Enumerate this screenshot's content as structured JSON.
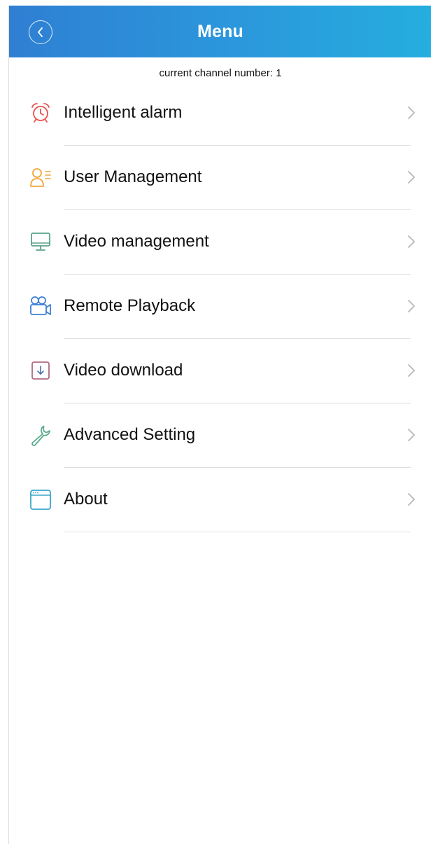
{
  "header": {
    "title": "Menu",
    "back_icon": "chevron-left-circle-icon"
  },
  "channel_info": "current channel number: 1",
  "menu": {
    "items": [
      {
        "label": "Intelligent alarm",
        "icon": "alarm-clock-icon",
        "icon_color": "#e8504f"
      },
      {
        "label": "User Management",
        "icon": "user-list-icon",
        "icon_color": "#f0a53a"
      },
      {
        "label": "Video management",
        "icon": "monitor-icon",
        "icon_color": "#5aa388"
      },
      {
        "label": "Remote Playback",
        "icon": "video-camera-icon",
        "icon_color": "#3d7fd6"
      },
      {
        "label": "Video download",
        "icon": "download-box-icon",
        "icon_color": "#b06a82"
      },
      {
        "label": "Advanced Setting",
        "icon": "wrench-icon",
        "icon_color": "#59ab8a"
      },
      {
        "label": "About",
        "icon": "browser-window-icon",
        "icon_color": "#3aa7c9"
      }
    ],
    "chevron_icon": "chevron-right-icon"
  },
  "colors": {
    "nav_gradient_start": "#2f7fd3",
    "nav_gradient_end": "#25aede",
    "divider": "#dedede",
    "chevron": "#b8b8b8"
  }
}
